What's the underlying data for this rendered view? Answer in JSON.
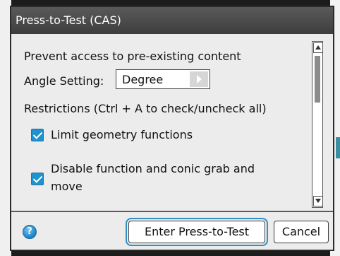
{
  "dialog": {
    "title": "Press-to-Test (CAS)"
  },
  "content": {
    "prevent_text": "Prevent access to pre-existing content",
    "angle_label": "Angle Setting:",
    "angle_value": "Degree",
    "restrictions_text": "Restrictions (Ctrl + A to check/uncheck all)",
    "checkboxes": [
      {
        "label": "Limit geometry functions",
        "checked": true
      },
      {
        "label": "Disable function and conic grab and move",
        "checked": true
      }
    ]
  },
  "buttons": {
    "enter": "Enter Press-to-Test",
    "cancel": "Cancel",
    "help": "?"
  },
  "colors": {
    "accent": "#1f93cf",
    "focus_outline": "#2f8fc4",
    "titlebar": "#4a4a4a"
  },
  "icons": {
    "help": "help-icon",
    "dropdown_arrow": "chevron-right-icon",
    "scroll_up": "arrow-up-icon",
    "scroll_down": "arrow-down-icon",
    "checkbox": "check-icon"
  }
}
